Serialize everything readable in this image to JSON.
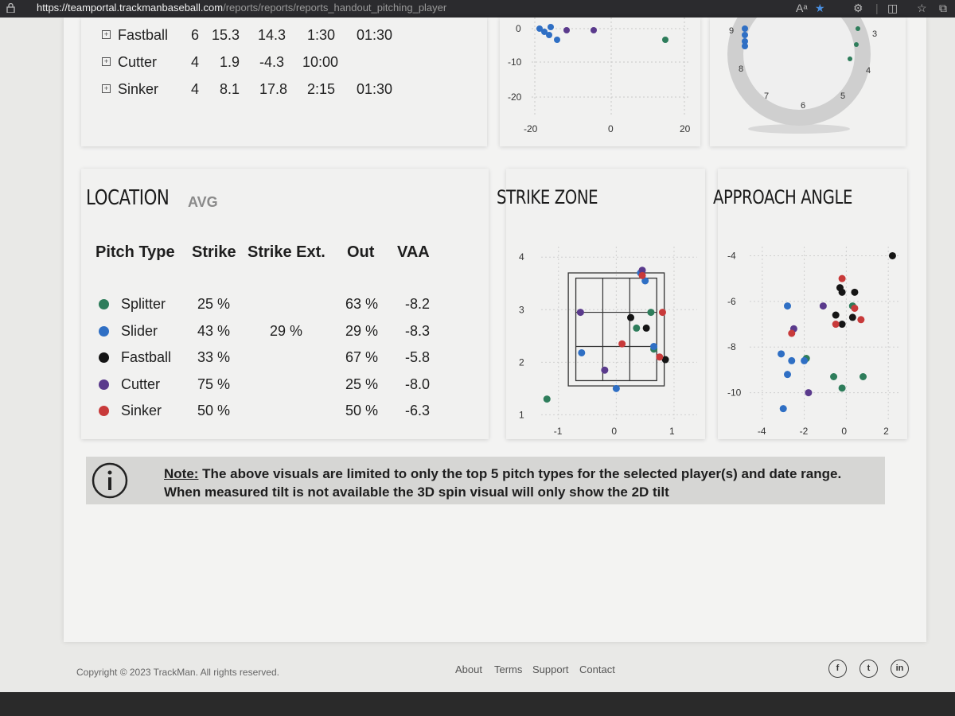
{
  "browser": {
    "url_host": "https://teamportal.trackmanbaseball.com",
    "url_path": "/reports/reports/reports_handout_pitching_player"
  },
  "movement_table": {
    "rows": [
      {
        "pitch": "Fastball",
        "count": "6",
        "a": "15.3",
        "b": "14.3",
        "tilt": "1:30",
        "spin_tilt": "01:30"
      },
      {
        "pitch": "Cutter",
        "count": "4",
        "a": "1.9",
        "b": "-4.3",
        "tilt": "10:00",
        "spin_tilt": ""
      },
      {
        "pitch": "Sinker",
        "count": "4",
        "a": "8.1",
        "b": "17.8",
        "tilt": "2:15",
        "spin_tilt": "01:30"
      }
    ]
  },
  "movement_chart_labels": {
    "y": [
      "0",
      "-10",
      "-20"
    ],
    "x": [
      "-20",
      "0",
      "20"
    ]
  },
  "clock_labels": [
    "9",
    "3",
    "8",
    "4",
    "7",
    "5",
    "6"
  ],
  "colors": {
    "Splitter": "#2e7d5b",
    "Slider": "#2f6fc4",
    "Fastball": "#151515",
    "Cutter": "#5a3a8c",
    "Sinker": "#c83a3a"
  },
  "location": {
    "title": "LOCATION",
    "subtitle": "AVG",
    "headers": {
      "pitch_type": "Pitch Type",
      "strike": "Strike",
      "strike_ext": "Strike Ext.",
      "out": "Out",
      "vaa": "VAA"
    },
    "rows": [
      {
        "pitch": "Splitter",
        "strike": "25 %",
        "strike_ext": "",
        "out": "63 %",
        "vaa": "-8.2",
        "color": "#2e7d5b"
      },
      {
        "pitch": "Slider",
        "strike": "43 %",
        "strike_ext": "29 %",
        "out": "29 %",
        "vaa": "-8.3",
        "color": "#2f6fc4"
      },
      {
        "pitch": "Fastball",
        "strike": "33 %",
        "strike_ext": "",
        "out": "67 %",
        "vaa": "-5.8",
        "color": "#151515"
      },
      {
        "pitch": "Cutter",
        "strike": "75 %",
        "strike_ext": "",
        "out": "25 %",
        "vaa": "-8.0",
        "color": "#5a3a8c"
      },
      {
        "pitch": "Sinker",
        "strike": "50 %",
        "strike_ext": "",
        "out": "50 %",
        "vaa": "-6.3",
        "color": "#c83a3a"
      }
    ]
  },
  "strike_zone": {
    "title": "STRIKE ZONE",
    "y_ticks": [
      "4",
      "3",
      "2",
      "1"
    ],
    "x_ticks": [
      "-1",
      "0",
      "1"
    ]
  },
  "approach_angle": {
    "title": "APPROACH ANGLE",
    "y_ticks": [
      "-4",
      "-6",
      "-8",
      "-10"
    ],
    "x_ticks": [
      "-4",
      "-2",
      "0",
      "2"
    ]
  },
  "chart_data": [
    {
      "type": "scatter",
      "title": "STRIKE ZONE",
      "xlim": [
        -1.3,
        1.4
      ],
      "ylim": [
        0.9,
        4.2
      ],
      "series": [
        {
          "name": "Splitter",
          "points": [
            [
              -1.2,
              1.3
            ],
            [
              0.6,
              2.95
            ],
            [
              0.35,
              2.65
            ],
            [
              0.65,
              2.25
            ]
          ]
        },
        {
          "name": "Slider",
          "points": [
            [
              0.5,
              3.55
            ],
            [
              0.42,
              3.7
            ],
            [
              0.65,
              2.3
            ],
            [
              -0.6,
              2.18
            ],
            [
              0.0,
              1.5
            ]
          ]
        },
        {
          "name": "Fastball",
          "points": [
            [
              0.25,
              2.85
            ],
            [
              0.52,
              2.65
            ],
            [
              0.85,
              2.05
            ]
          ]
        },
        {
          "name": "Cutter",
          "points": [
            [
              -0.62,
              2.95
            ],
            [
              0.45,
              3.75
            ],
            [
              -0.2,
              1.85
            ]
          ]
        },
        {
          "name": "Sinker",
          "points": [
            [
              0.8,
              2.95
            ],
            [
              0.45,
              3.65
            ],
            [
              0.1,
              2.35
            ],
            [
              0.75,
              2.1
            ]
          ]
        }
      ]
    },
    {
      "type": "scatter",
      "title": "APPROACH ANGLE",
      "xlim": [
        -4.6,
        2.6
      ],
      "ylim": [
        -11.2,
        -3.6
      ],
      "series": [
        {
          "name": "Splitter",
          "points": [
            [
              -1.9,
              -8.5
            ],
            [
              0.3,
              -6.2
            ],
            [
              -0.6,
              -9.3
            ],
            [
              -0.2,
              -9.8
            ],
            [
              0.8,
              -9.3
            ]
          ]
        },
        {
          "name": "Slider",
          "points": [
            [
              -2.8,
              -6.2
            ],
            [
              -3.1,
              -8.3
            ],
            [
              -2.6,
              -8.6
            ],
            [
              -2.8,
              -9.2
            ],
            [
              -2.0,
              -8.6
            ],
            [
              -3.0,
              -10.7
            ]
          ]
        },
        {
          "name": "Fastball",
          "points": [
            [
              2.2,
              -4.0
            ],
            [
              -0.3,
              -5.4
            ],
            [
              -0.2,
              -5.6
            ],
            [
              0.4,
              -5.6
            ],
            [
              -0.5,
              -6.6
            ],
            [
              0.3,
              -6.7
            ],
            [
              -0.2,
              -7.0
            ]
          ]
        },
        {
          "name": "Cutter",
          "points": [
            [
              -1.1,
              -6.2
            ],
            [
              -2.5,
              -7.2
            ],
            [
              -1.8,
              -10.0
            ]
          ]
        },
        {
          "name": "Sinker",
          "points": [
            [
              -0.2,
              -5.0
            ],
            [
              0.4,
              -6.3
            ],
            [
              -0.5,
              -7.0
            ],
            [
              0.7,
              -6.8
            ],
            [
              -2.6,
              -7.4
            ]
          ]
        }
      ]
    }
  ],
  "note": {
    "label": "Note:",
    "line1": " The above visuals are limited to only the top 5 pitch types for the selected player(s) and date range.",
    "line2": "When measured tilt is not available the 3D spin visual will only show the 2D tilt"
  },
  "footer": {
    "copyright": "Copyright © 2023 TrackMan. All rights reserved.",
    "links": [
      "About",
      "Terms",
      "Support",
      "Contact"
    ],
    "social": [
      "f",
      "t",
      "in"
    ]
  }
}
